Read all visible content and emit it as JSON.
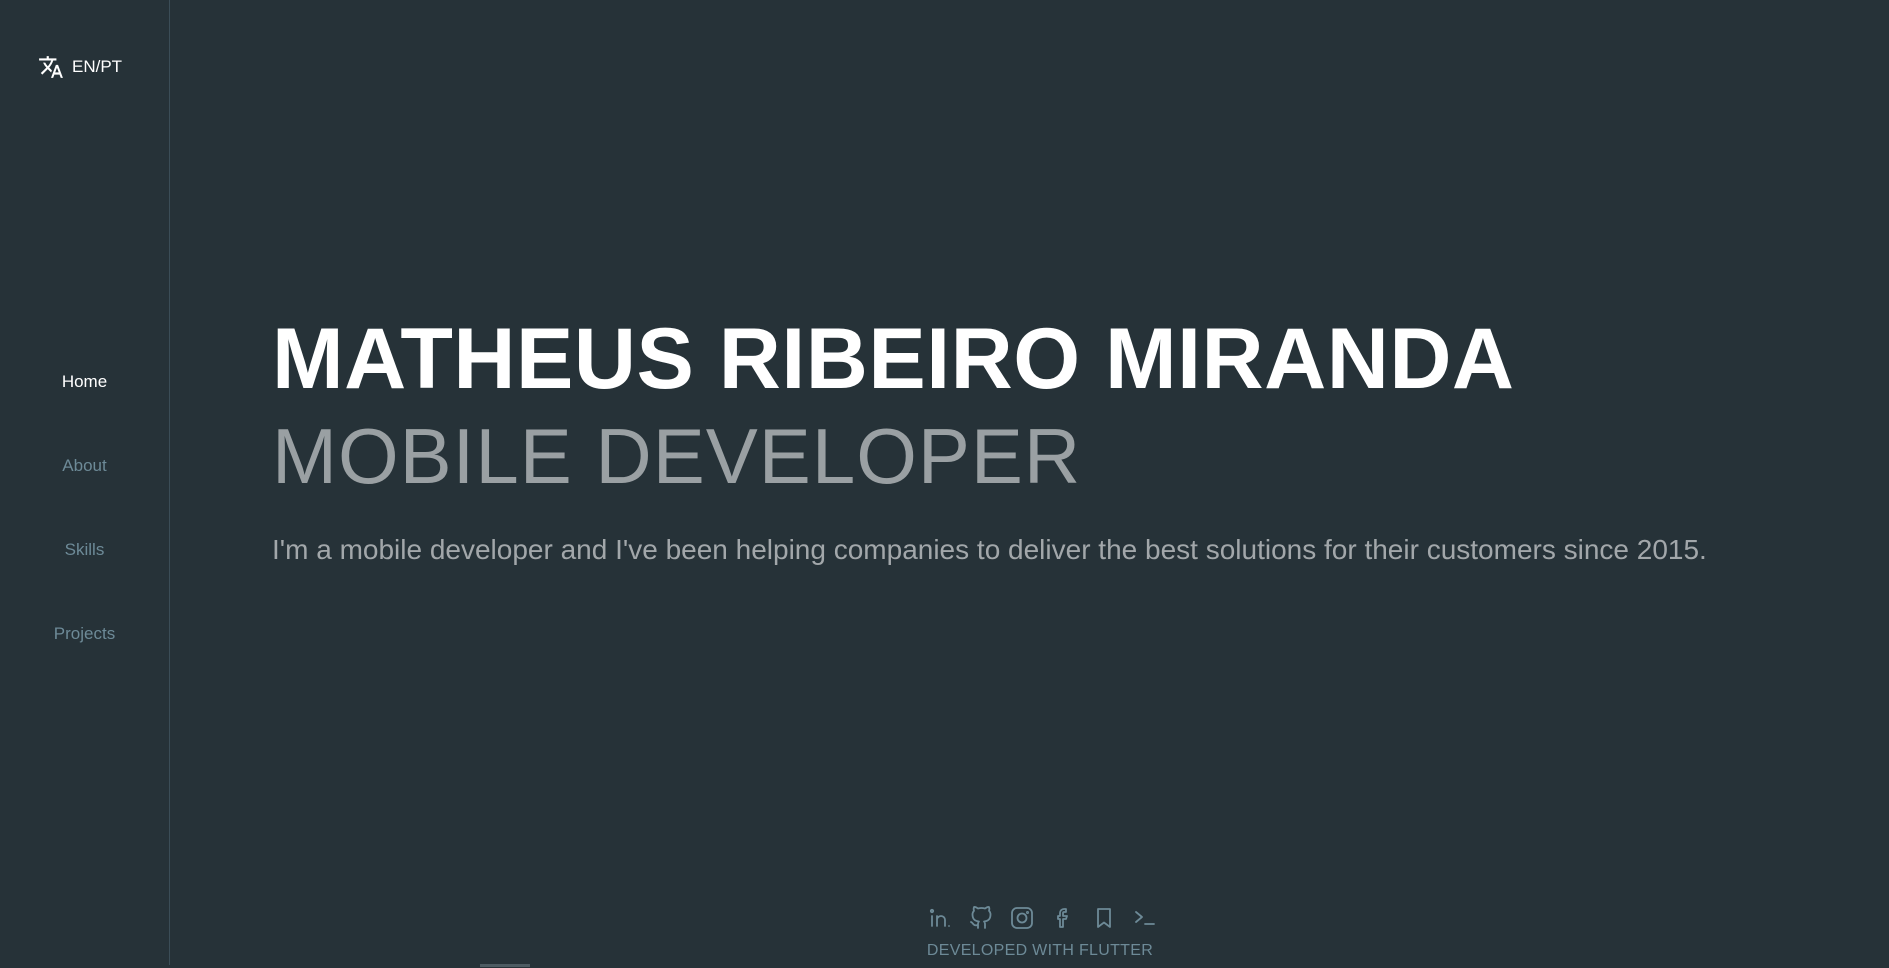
{
  "language_toggle": {
    "label": "EN/PT",
    "icon": "translate-icon"
  },
  "nav": {
    "items": [
      {
        "label": "Home",
        "active": true
      },
      {
        "label": "About",
        "active": false
      },
      {
        "label": "Skills",
        "active": false
      },
      {
        "label": "Projects",
        "active": false
      }
    ]
  },
  "hero": {
    "name": "MATHEUS RIBEIRO MIRANDA",
    "role": "MOBILE DEVELOPER",
    "description": "I'm a mobile developer and I've been helping companies to deliver the best solutions for their customers since 2015."
  },
  "socials": [
    "linkedin-icon",
    "github-icon",
    "instagram-icon",
    "facebook-icon",
    "bookmark-icon",
    "terminal-icon"
  ],
  "footer": {
    "text": "DEVELOPED WITH FLUTTER"
  },
  "colors": {
    "background": "#263238",
    "active_nav": "#ffffff",
    "inactive_nav": "#6d8a97",
    "role_text": "#9aa0a3"
  }
}
